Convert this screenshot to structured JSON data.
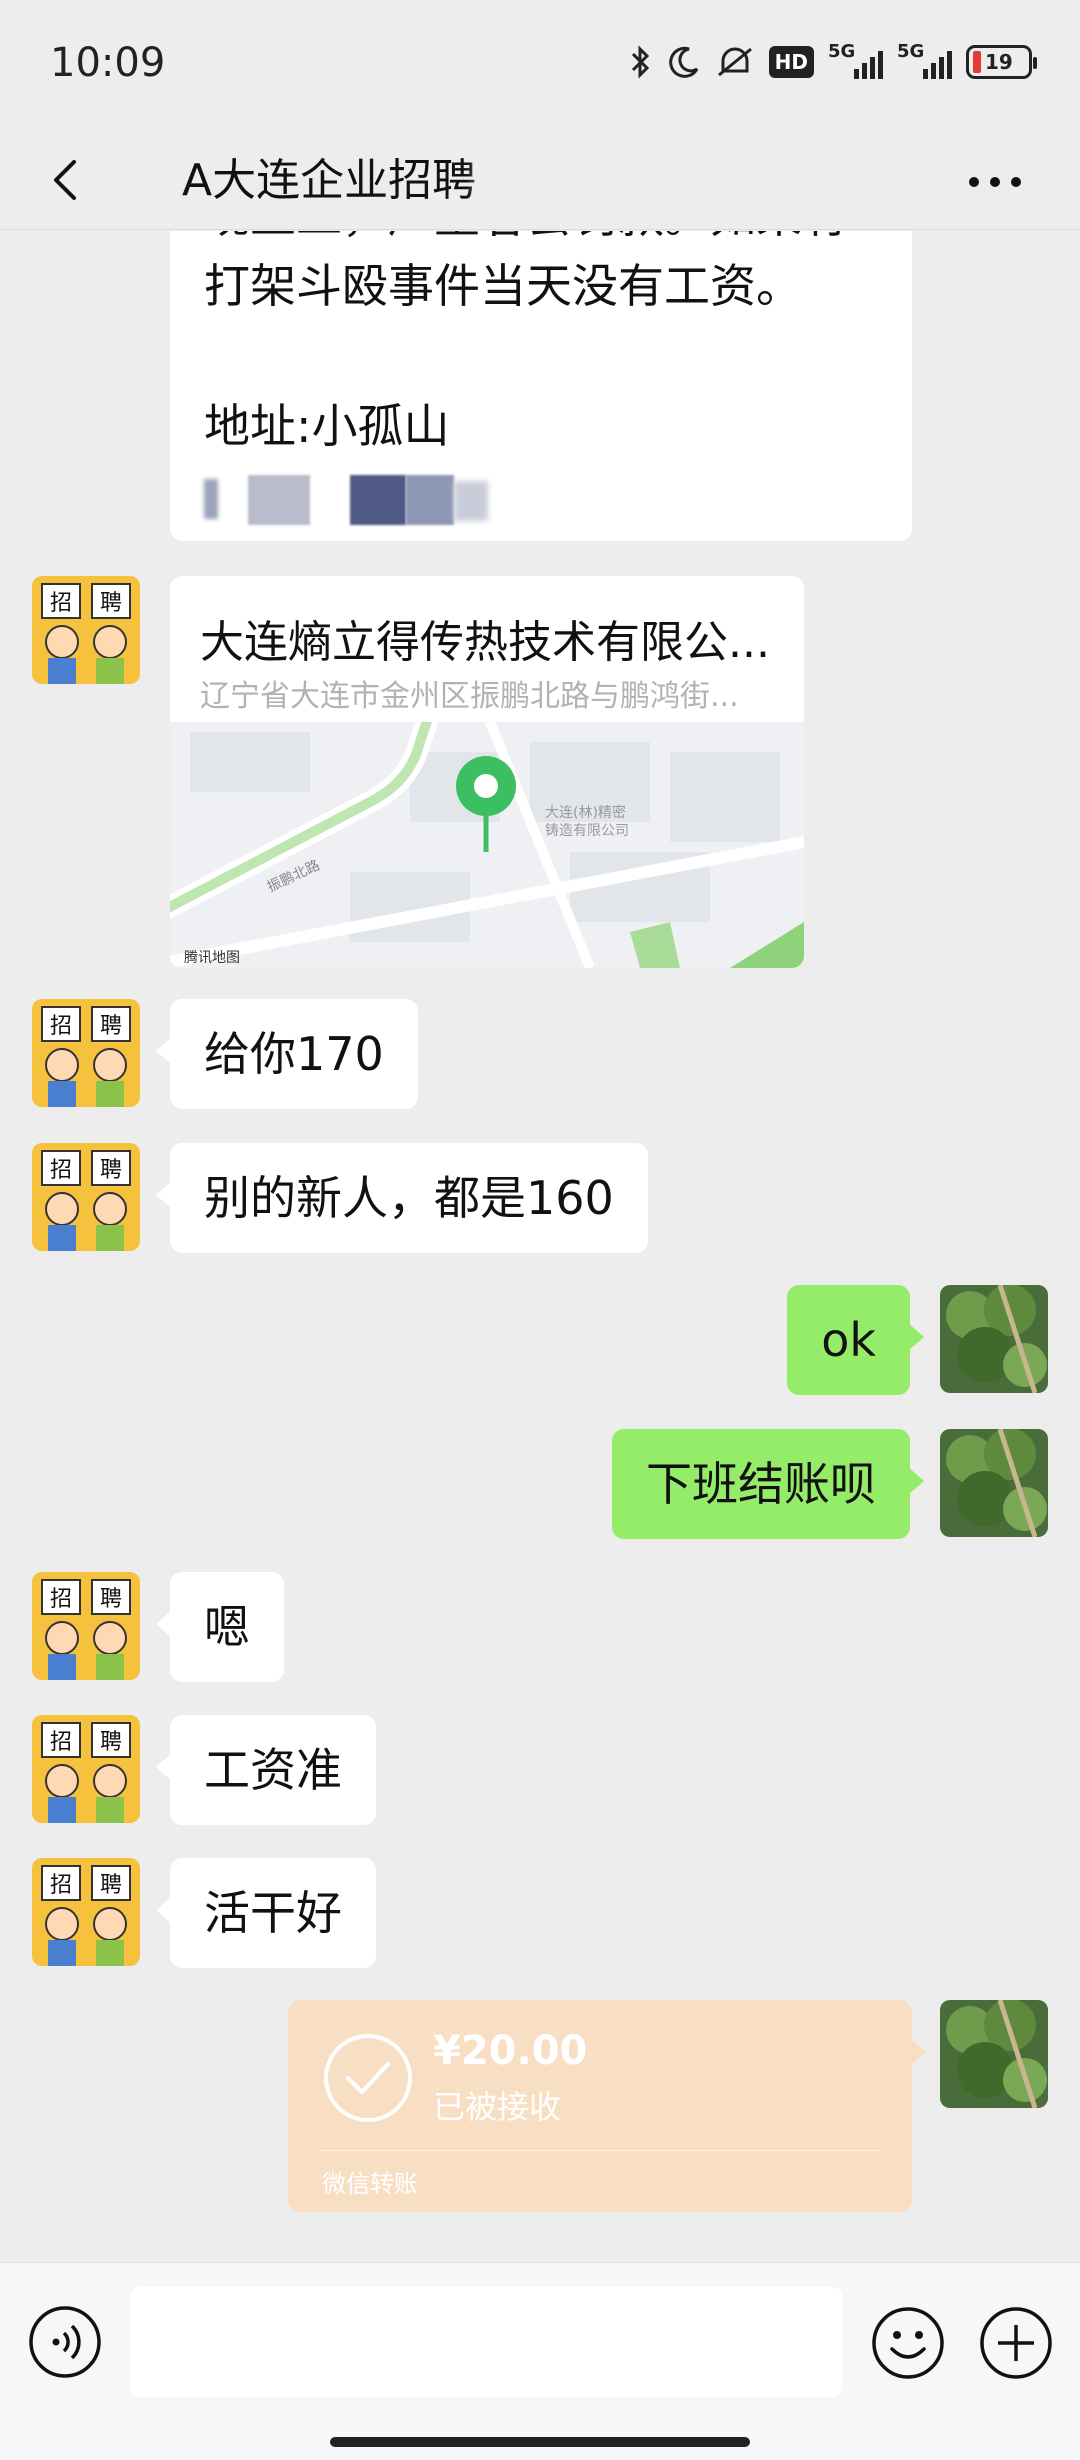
{
  "status_bar": {
    "time": "10:09",
    "icons": [
      "bluetooth-icon",
      "moon-icon",
      "mute-icon",
      "hd-icon",
      "signal-icon",
      "signal-icon",
      "battery-icon"
    ],
    "hd_label": "HD",
    "network_1": "5G",
    "network_2": "5G",
    "battery_level": "19"
  },
  "header": {
    "title": "A大连企业招聘",
    "back_icon": "chevron-left-icon",
    "more_icon": "more-dots-icon"
  },
  "messages": {
    "text_card": {
      "line1": "现上工，严重者会罚款。如果有",
      "line2": "打架斗殴事件当天没有工资。",
      "line3": "地址:小孤山"
    },
    "location": {
      "name": "大连熵立得传热技术有限公...",
      "address": "辽宁省大连市金州区振鹏北路与鹏鸿街...",
      "map_road_label": "振鹏北路",
      "map_poi_label_1": "大连(林)精密",
      "map_poi_label_2": "铸造有限公司",
      "map_source": "腾讯地图"
    },
    "m1": "给你170",
    "m2": "别的新人，都是160",
    "m3": "ok",
    "m4": "下班结账呗",
    "m5": "嗯",
    "m6": "工资准",
    "m7": "活干好",
    "transfer": {
      "amount": "¥20.00",
      "status": "已被接收",
      "footer": "微信转账"
    }
  },
  "input_bar": {
    "placeholder": "",
    "voice_icon": "voice-icon",
    "emoji_icon": "emoji-icon",
    "plus_icon": "plus-icon"
  },
  "colors": {
    "background": "#ededed",
    "sent_bubble": "#95ec69",
    "received_bubble": "#ffffff",
    "transfer_card": "#f8dfc4",
    "map_pin": "#3cbf61"
  }
}
